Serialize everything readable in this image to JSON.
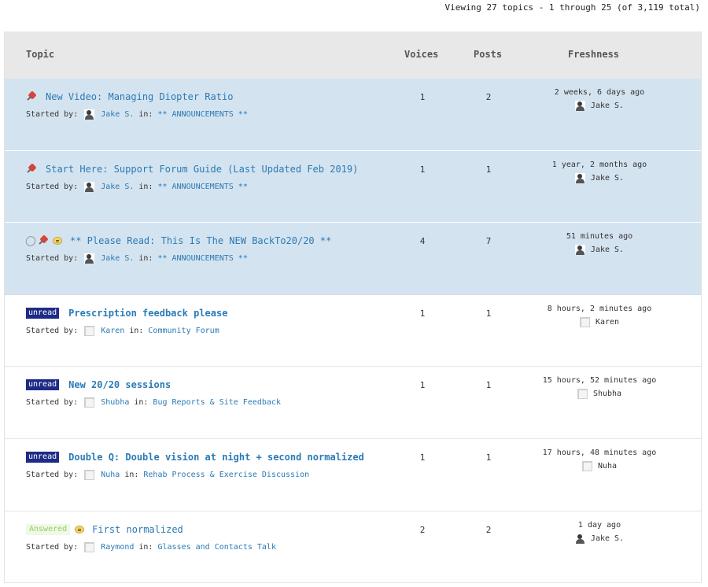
{
  "pagination": {
    "text": "Viewing 27 topics - 1 through 25 (of 3,119 total)"
  },
  "header": {
    "topic": "Topic",
    "voices": "Voices",
    "posts": "Posts",
    "freshness": "Freshness"
  },
  "labels": {
    "started_by": "Started by:",
    "in": "in:"
  },
  "topics": [
    {
      "title": "New Video: Managing Diopter Ratio",
      "author": "Jake S.",
      "forum": "** ANNOUNCEMENTS **",
      "voices": "1",
      "posts": "2",
      "freshness": "2 weeks, 6 days ago",
      "last_poster": "Jake S.",
      "badge": "",
      "sticky": true,
      "icons": [
        "pin-icon"
      ]
    },
    {
      "title": "Start Here: Support Forum Guide (Last Updated Feb 2019)",
      "author": "Jake S.",
      "forum": "** ANNOUNCEMENTS **",
      "voices": "1",
      "posts": "1",
      "freshness": "1 year, 2 months ago",
      "last_poster": "Jake S.",
      "badge": "",
      "sticky": true,
      "icons": [
        "pin-icon"
      ]
    },
    {
      "title": "** Please Read: This Is The NEW BackTo20/20 **",
      "author": "Jake S.",
      "forum": "** ANNOUNCEMENTS **",
      "voices": "4",
      "posts": "7",
      "freshness": "51 minutes ago",
      "last_poster": "Jake S.",
      "badge": "",
      "sticky": true,
      "icons": [
        "paperclip-icon",
        "pin-icon",
        "speech-bubble-icon"
      ]
    },
    {
      "title": "Prescription feedback please",
      "author": "Karen",
      "forum": "Community Forum",
      "voices": "1",
      "posts": "1",
      "freshness": "8 hours, 2 minutes ago",
      "last_poster": "Karen",
      "badge": "unread",
      "sticky": false,
      "icons": []
    },
    {
      "title": "New 20/20 sessions",
      "author": "Shubha",
      "forum": "Bug Reports & Site Feedback",
      "voices": "1",
      "posts": "1",
      "freshness": "15 hours, 52 minutes ago",
      "last_poster": "Shubha",
      "badge": "unread",
      "sticky": false,
      "icons": []
    },
    {
      "title": "Double Q: Double vision at night + second normalized",
      "author": "Nuha",
      "forum": "Rehab Process & Exercise Discussion",
      "voices": "1",
      "posts": "1",
      "freshness": "17 hours, 48 minutes ago",
      "last_poster": "Nuha",
      "badge": "unread",
      "sticky": false,
      "icons": []
    },
    {
      "title": "First normalized",
      "author": "Raymond",
      "forum": "Glasses and Contacts Talk",
      "voices": "2",
      "posts": "2",
      "freshness": "1 day ago",
      "last_poster": "Jake S.",
      "badge": "Answered",
      "sticky": false,
      "icons": [
        "speech-bubble-icon"
      ]
    }
  ]
}
